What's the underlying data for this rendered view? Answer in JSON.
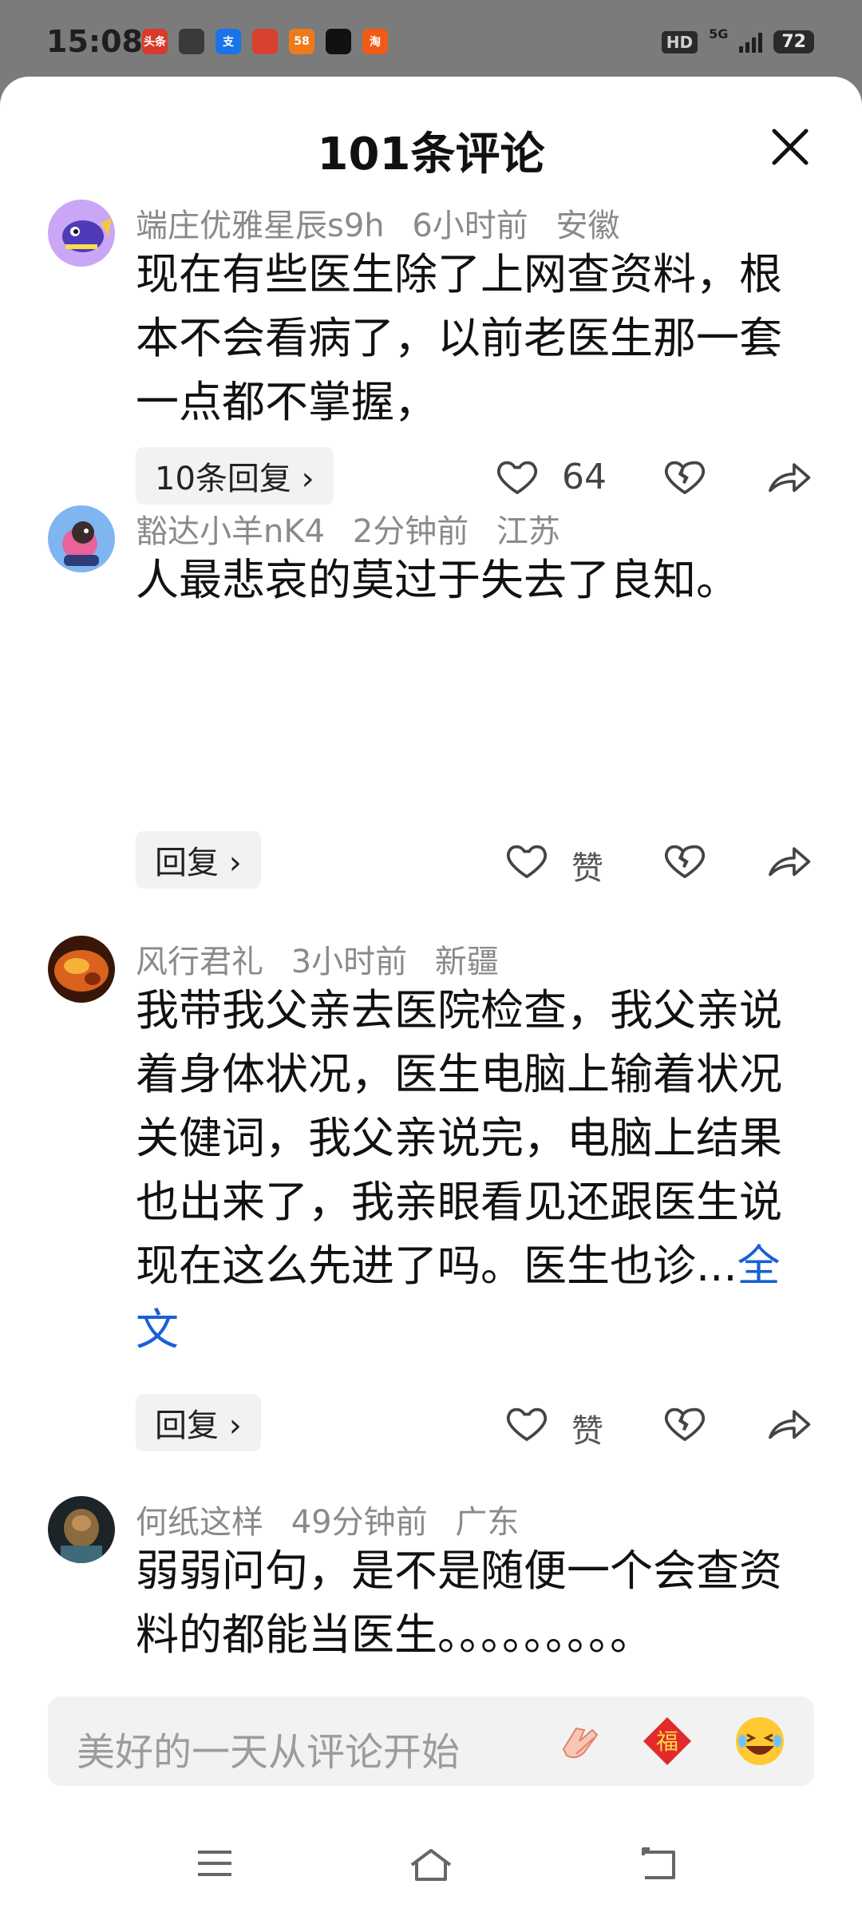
{
  "status_bar": {
    "time": "15:08",
    "apps": [
      {
        "name": "toutiao-icon",
        "label": "头条",
        "color": "#d93a2b"
      },
      {
        "name": "link-icon",
        "label": "",
        "color": "#3a3a3a"
      },
      {
        "name": "alipay-icon",
        "label": "支",
        "color": "#1a73e8"
      },
      {
        "name": "red-app-icon",
        "label": "",
        "color": "#d8402f"
      },
      {
        "name": "app-58-icon",
        "label": "58",
        "color": "#ef7a1a"
      },
      {
        "name": "tiktok-icon",
        "label": "",
        "color": "#111111"
      },
      {
        "name": "taobao-icon",
        "label": "淘",
        "color": "#f25a18"
      }
    ],
    "hd": "HD",
    "network": "5G",
    "battery": "72"
  },
  "sheet": {
    "title": "101条评论",
    "close_icon": "close-icon"
  },
  "comments": [
    {
      "user": "端庄优雅星辰s9h",
      "time": "6小时前",
      "location": "安徽",
      "text": "现在有些医生除了上网查资料，根本不会看病了，以前老医生那一套一点都不掌握，",
      "reply_label": "10条回复 ›",
      "likes": "64",
      "avatar_color": "#b58df2"
    },
    {
      "user": "豁达小羊nK4",
      "time": "2分钟前",
      "location": "江苏",
      "text": "人最悲哀的莫过于失去了良知。",
      "reply_label": "回复 ›",
      "likes": "赞",
      "avatar_color": "#7fb3f5"
    },
    {
      "user": "风行君礼",
      "time": "3小时前",
      "location": "新疆",
      "text": "我带我父亲去医院检查，我父亲说着身体状况，医生电脑上输着状况关健词，我父亲说完，电脑上结果也出来了，我亲眼看见还跟医生说现在这么先进了吗。医生也诊...",
      "full_link": "全文",
      "reply_label": "回复 ›",
      "likes": "赞",
      "avatar_color": "#c9521c"
    },
    {
      "user": "何纸这样",
      "time": "49分钟前",
      "location": "广东",
      "text": "弱弱问句，是不是随便一个会查资料的都能当医生。。。。。。。。。",
      "avatar_color": "#3b3a36"
    }
  ],
  "input": {
    "placeholder": "美好的一天从评论开始",
    "emojis": [
      "clap-emoji",
      "fu-emoji",
      "laugh-emoji"
    ],
    "fu_label": "福"
  },
  "nav": [
    "menu-icon",
    "home-icon",
    "back-icon"
  ]
}
